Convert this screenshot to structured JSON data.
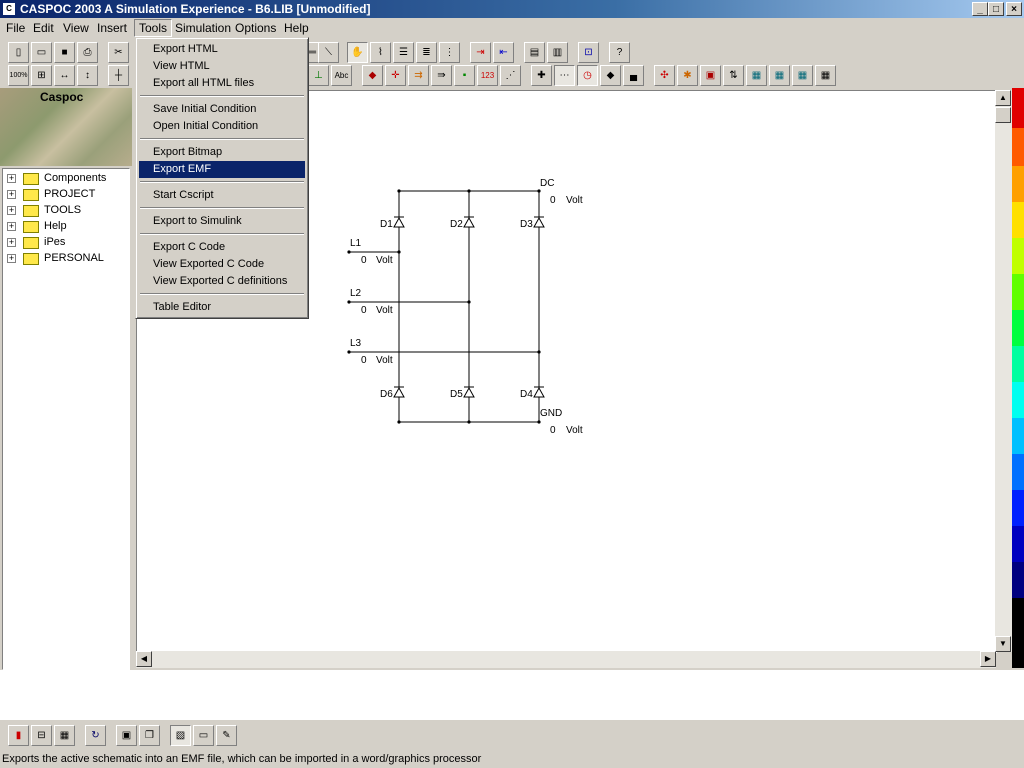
{
  "window": {
    "title": "CASPOC 2003 A Simulation Experience - B6.LIB [Unmodified]"
  },
  "menubar": {
    "items": [
      "File",
      "Edit",
      "View",
      "Insert",
      "Tools",
      "Simulation",
      "Options",
      "Help"
    ]
  },
  "tools_menu": {
    "items": [
      "Export HTML",
      "View HTML",
      "Export all HTML files",
      "Save Initial Condition",
      "Open Initial Condition",
      "Export Bitmap",
      "Export EMF",
      "Start Cscript",
      "Export to Simulink",
      "Export C Code",
      "View Exported C Code",
      "View Exported C definitions",
      "Table Editor"
    ],
    "highlighted": "Export EMF"
  },
  "left_panel": {
    "logo_text": "Caspoc",
    "tree": [
      "Components",
      "PROJECT",
      "TOOLS",
      "Help",
      "iPes",
      "PERSONAL"
    ]
  },
  "toolbar": {
    "zoom_label": "100%",
    "text_tool_label": "Abc",
    "counter_label": "123"
  },
  "schematic": {
    "nodes": [
      {
        "name": "DC",
        "value": "0",
        "unit": "Volt"
      },
      {
        "name": "L1",
        "value": "0",
        "unit": "Volt"
      },
      {
        "name": "L2",
        "value": "0",
        "unit": "Volt"
      },
      {
        "name": "L3",
        "value": "0",
        "unit": "Volt"
      },
      {
        "name": "GND",
        "value": "0",
        "unit": "Volt"
      }
    ],
    "diodes": [
      "D1",
      "D2",
      "D3",
      "D4",
      "D5",
      "D6"
    ]
  },
  "status": {
    "text": "Exports the active schematic into an EMF file, which can be imported in a word/graphics processor"
  },
  "colors": {
    "title_active": "#0a246a",
    "menu_highlight": "#0a246a",
    "face": "#d4d0c8"
  }
}
